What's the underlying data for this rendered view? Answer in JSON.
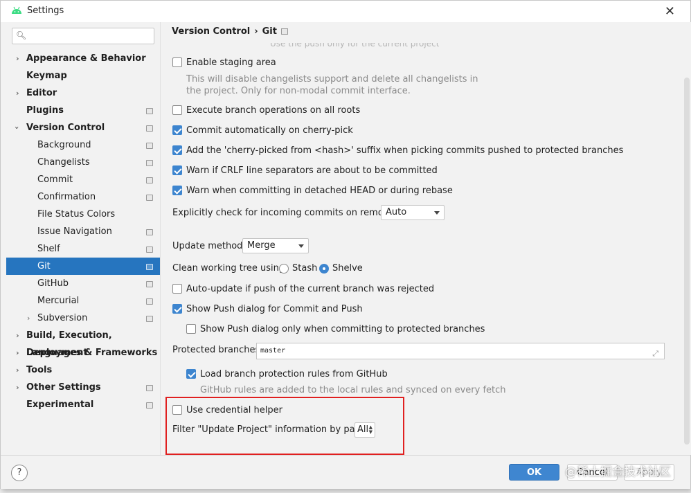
{
  "window": {
    "title": "Settings"
  },
  "search": {
    "placeholder": ""
  },
  "sidebar": {
    "items": [
      {
        "label": "Appearance & Behavior"
      },
      {
        "label": "Keymap"
      },
      {
        "label": "Editor"
      },
      {
        "label": "Plugins"
      },
      {
        "label": "Version Control"
      },
      {
        "label": "Background"
      },
      {
        "label": "Changelists"
      },
      {
        "label": "Commit"
      },
      {
        "label": "Confirmation"
      },
      {
        "label": "File Status Colors"
      },
      {
        "label": "Issue Navigation"
      },
      {
        "label": "Shelf"
      },
      {
        "label": "Git"
      },
      {
        "label": "GitHub"
      },
      {
        "label": "Mercurial"
      },
      {
        "label": "Subversion"
      },
      {
        "label": "Build, Execution, Deployment"
      },
      {
        "label": "Languages & Frameworks"
      },
      {
        "label": "Tools"
      },
      {
        "label": "Other Settings"
      },
      {
        "label": "Experimental"
      }
    ]
  },
  "breadcrumb": {
    "part1": "Version Control",
    "sep": "›",
    "part2": "Git"
  },
  "git": {
    "faded_top": "Use the push only for the current project",
    "staging": {
      "label": "Enable staging area",
      "checked": false,
      "hint1": "This will disable changelists support and delete all changelists in",
      "hint2": "the project. Only for non-modal commit interface."
    },
    "branch_ops": {
      "label": "Execute branch operations on all roots",
      "checked": false
    },
    "cherry_pick": {
      "label": "Commit automatically on cherry-pick",
      "checked": true
    },
    "cherry_suffix": {
      "label": "Add the 'cherry-picked from <hash>' suffix when picking commits pushed to protected branches",
      "checked": true
    },
    "crlf": {
      "label": "Warn if CRLF line separators are about to be committed",
      "checked": true
    },
    "detached": {
      "label": "Warn when committing in detached HEAD or during rebase",
      "checked": true
    },
    "incoming": {
      "label": "Explicitly check for incoming commits on remotes:",
      "value": "Auto"
    },
    "update_method": {
      "label": "Update method:",
      "value": "Merge"
    },
    "clean_tree": {
      "label": "Clean working tree using:",
      "opt1": "Stash",
      "opt2": "Shelve",
      "selected": "Shelve"
    },
    "auto_update": {
      "label": "Auto-update if push of the current branch was rejected",
      "checked": false
    },
    "push_dialog": {
      "label": "Show Push dialog for Commit and Push",
      "checked": true
    },
    "push_protected": {
      "label": "Show Push dialog only when committing to protected branches",
      "checked": false
    },
    "protected": {
      "label": "Protected branches:",
      "value": "master"
    },
    "github_rules": {
      "label": "Load branch protection rules from GitHub",
      "checked": true,
      "hint": "GitHub rules are added to the local rules and synced on every fetch"
    },
    "credential": {
      "label": "Use credential helper",
      "checked": false
    },
    "filter": {
      "label": "Filter \"Update Project\" information by paths:",
      "value": "All"
    }
  },
  "footer": {
    "help": "?",
    "ok": "OK",
    "cancel": "Cancel",
    "apply": "Apply"
  },
  "watermark": "@稀土掘金技术社区",
  "colors": {
    "accent": "#2675bf",
    "highlight_box": "#e02020",
    "ok_button": "#3f86d0"
  }
}
